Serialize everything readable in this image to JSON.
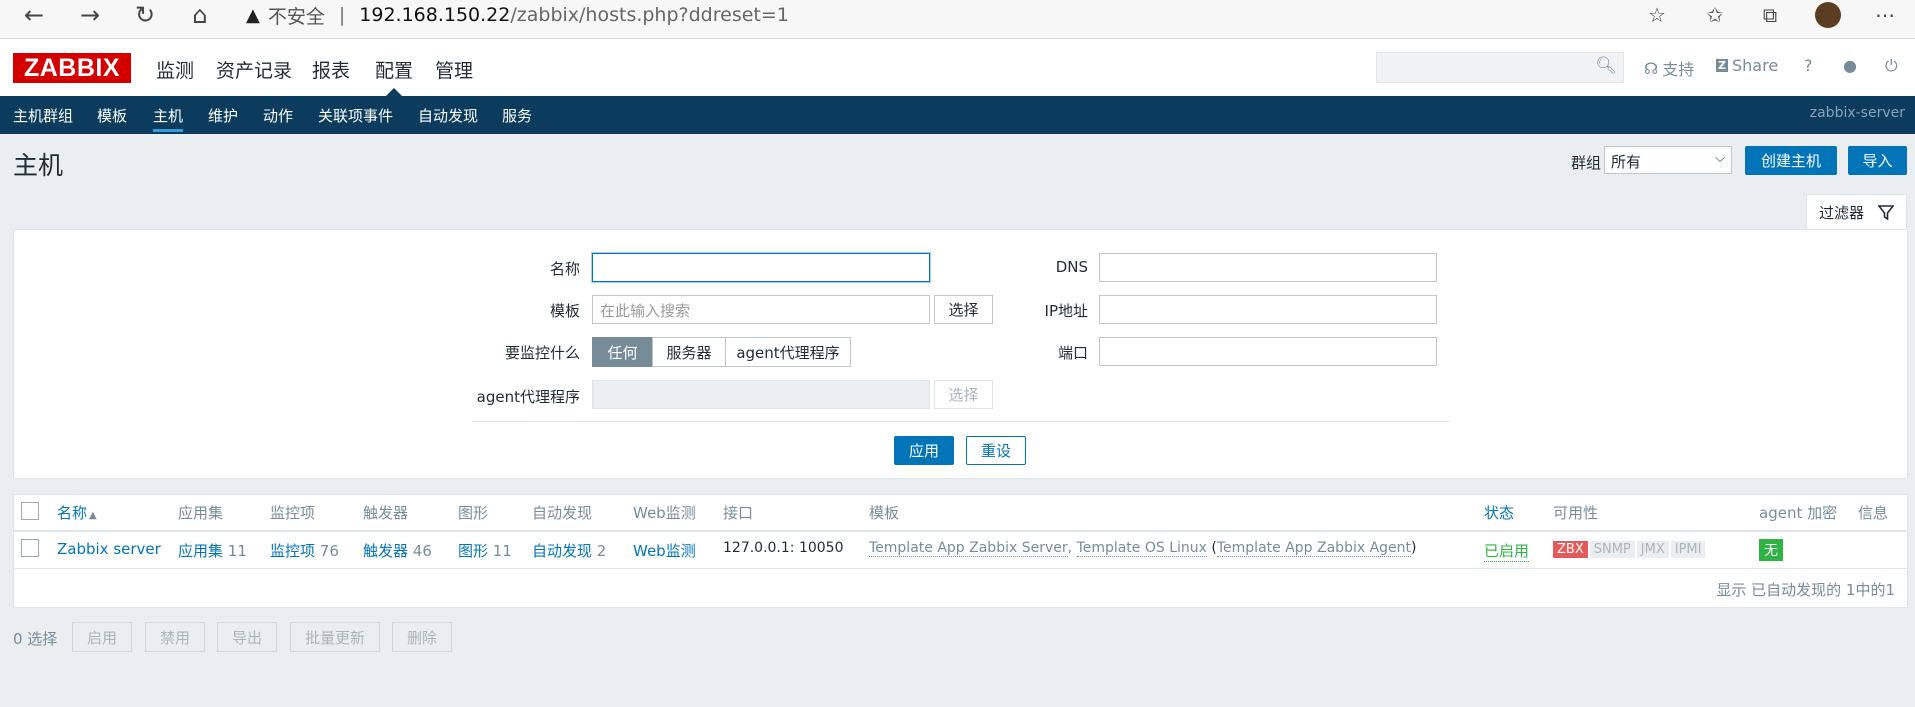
{
  "browser": {
    "insecure_label": "不安全",
    "separator": "|",
    "url_host": "192.168.150.22",
    "url_path": "/zabbix/hosts.php?ddreset=1"
  },
  "logo": "ZABBIX",
  "topnav": [
    "监测",
    "资产记录",
    "报表",
    "配置",
    "管理"
  ],
  "topnav_selected": "配置",
  "header_links": {
    "support": "支持",
    "share": "Share",
    "help": "?"
  },
  "subnav": [
    "主机群组",
    "模板",
    "主机",
    "维护",
    "动作",
    "关联项事件",
    "自动发现",
    "服务"
  ],
  "subnav_selected": "主机",
  "server_name": "zabbix-server",
  "page_title": "主机",
  "group_label": "群组",
  "group_value": "所有",
  "create_host_label": "创建主机",
  "import_label": "导入",
  "filter": {
    "tab_label": "过滤器",
    "name_label": "名称",
    "name_value": "",
    "template_label": "模板",
    "template_placeholder": "在此输入搜索",
    "select_label": "选择",
    "monitor_label": "要监控什么",
    "monitor_options": [
      "任何",
      "服务器",
      "agent代理程序"
    ],
    "monitor_selected": "任何",
    "proxy_label": "agent代理程序",
    "dns_label": "DNS",
    "ip_label": "IP地址",
    "port_label": "端口",
    "apply_label": "应用",
    "reset_label": "重设"
  },
  "table": {
    "columns": [
      "名称",
      "应用集",
      "监控项",
      "触发器",
      "图形",
      "自动发现",
      "Web监测",
      "接口",
      "模板",
      "状态",
      "可用性",
      "agent 加密",
      "信息"
    ],
    "sort_arrow": "▲",
    "rows": [
      {
        "name": "Zabbix server",
        "apps_label": "应用集",
        "apps_count": "11",
        "items_label": "监控项",
        "items_count": "76",
        "triggers_label": "触发器",
        "triggers_count": "46",
        "graphs_label": "图形",
        "graphs_count": "11",
        "discovery_label": "自动发现",
        "discovery_count": "2",
        "web_label": "Web监测",
        "interface": "127.0.0.1: 10050",
        "template_1": "Template App Zabbix Server",
        "template_comma": ", ",
        "template_2": "Template OS Linux",
        "template_paren_open": " (",
        "template_3": "Template App Zabbix Agent",
        "template_paren_close": ")",
        "status": "已启用",
        "avail": [
          "ZBX",
          "SNMP",
          "JMX",
          "IPMI"
        ],
        "encryption": "无"
      }
    ],
    "footer": "显示 已自动发现的 1中的1"
  },
  "actions": {
    "selected_count": "0 选择",
    "buttons": [
      "启用",
      "禁用",
      "导出",
      "批量更新",
      "删除"
    ]
  },
  "colors": {
    "brand_red": "#d40000",
    "nav_blue": "#0b3c5d",
    "link_blue": "#0275b8",
    "status_green": "#2fb344",
    "zbx_red": "#e45959"
  }
}
